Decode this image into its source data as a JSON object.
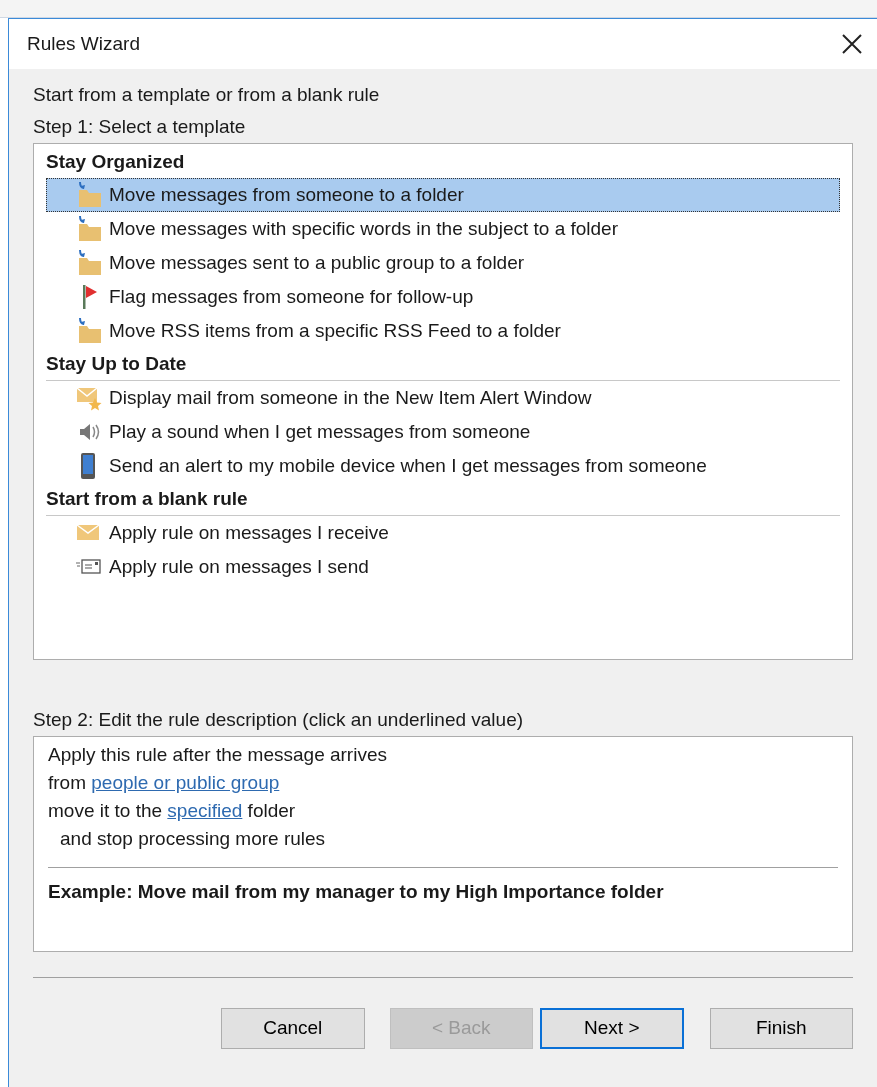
{
  "window": {
    "title": "Rules Wizard"
  },
  "intro": "Start from a template or from a blank rule",
  "step1_label": "Step 1: Select a template",
  "template_groups": [
    {
      "heading": "Stay Organized",
      "items": [
        {
          "kind": "folder-move",
          "label": "Move messages from someone to a folder",
          "selected": true
        },
        {
          "kind": "folder-move",
          "label": "Move messages with specific words in the subject to a folder",
          "selected": false
        },
        {
          "kind": "folder-move",
          "label": "Move messages sent to a public group to a folder",
          "selected": false
        },
        {
          "kind": "flag",
          "label": "Flag messages from someone for follow-up",
          "selected": false
        },
        {
          "kind": "folder-move",
          "label": "Move RSS items from a specific RSS Feed to a folder",
          "selected": false
        }
      ]
    },
    {
      "heading": "Stay Up to Date",
      "items": [
        {
          "kind": "mail-star",
          "label": "Display mail from someone in the New Item Alert Window",
          "selected": false
        },
        {
          "kind": "speaker",
          "label": "Play a sound when I get messages from someone",
          "selected": false
        },
        {
          "kind": "phone",
          "label": "Send an alert to my mobile device when I get messages from someone",
          "selected": false
        }
      ]
    },
    {
      "heading": "Start from a blank rule",
      "items": [
        {
          "kind": "mail",
          "label": "Apply rule on messages I receive",
          "selected": false
        },
        {
          "kind": "mail-send",
          "label": "Apply rule on messages I send",
          "selected": false
        }
      ]
    }
  ],
  "step2_label": "Step 2: Edit the rule description (click an underlined value)",
  "description": {
    "lines": [
      {
        "indent": false,
        "segments": [
          {
            "text": "Apply this rule after the message arrives",
            "link": false
          }
        ]
      },
      {
        "indent": false,
        "segments": [
          {
            "text": "from ",
            "link": false
          },
          {
            "text": "people or public group",
            "link": true
          }
        ]
      },
      {
        "indent": false,
        "segments": [
          {
            "text": "move it to the ",
            "link": false
          },
          {
            "text": "specified",
            "link": true
          },
          {
            "text": " folder",
            "link": false
          }
        ]
      },
      {
        "indent": true,
        "segments": [
          {
            "text": "and stop processing more rules",
            "link": false
          }
        ]
      }
    ],
    "example": "Example: Move mail from my manager to my High Importance folder"
  },
  "buttons": [
    {
      "label": "Cancel",
      "disabled": false,
      "default": false
    },
    {
      "label": "< Back",
      "disabled": true,
      "default": false
    },
    {
      "label": "Next >",
      "disabled": false,
      "default": true
    },
    {
      "label": "Finish",
      "disabled": false,
      "default": false
    }
  ]
}
